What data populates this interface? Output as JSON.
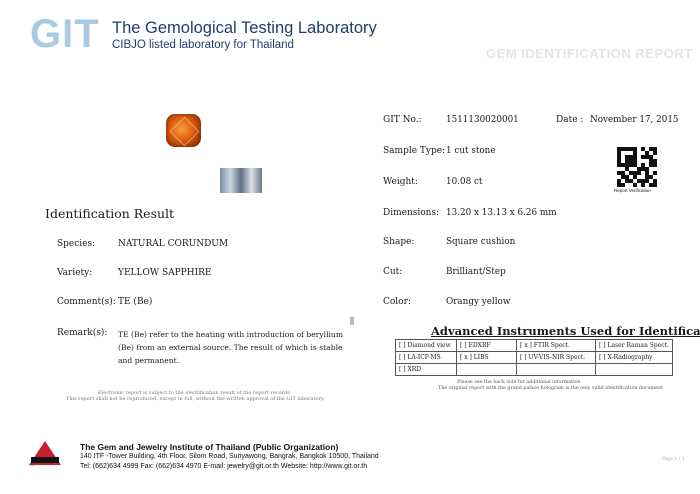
{
  "header": {
    "logo": "GIT",
    "title": "The Gemological Testing Laboratory",
    "subtitle": "CIBJO listed laboratory for Thailand",
    "watermark": "GEM IDENTIFICATION REPORT"
  },
  "identification": {
    "heading": "Identification Result",
    "species": {
      "label": "Species:",
      "value": "NATURAL  CORUNDUM"
    },
    "variety": {
      "label": "Variety:",
      "value": "YELLOW  SAPPHIRE"
    },
    "comments": {
      "label": "Comment(s):",
      "value": "TE (Be)"
    },
    "remarks": {
      "label": "Remark(s):",
      "value": "TE (Be) refer to the heating with introduction of beryllium (Be) from an external source. The result of which is stable and permanent."
    }
  },
  "disclaimer": {
    "line1": "Electronic report is subject to the identification result of the report records.",
    "line2": "This report shall not be reproduced, except in full, without the written approval of the GIT laboratory."
  },
  "report": {
    "git_no": {
      "label": "GIT No.:",
      "value": "1511130020001"
    },
    "date": {
      "label": "Date :",
      "value": "November 17, 2015"
    },
    "sample_type": {
      "label": "Sample Type:",
      "value": "1 cut stone"
    },
    "weight": {
      "label": "Weight:",
      "value": "10.08  ct"
    },
    "dimensions": {
      "label": "Dimensions:",
      "value": "13.20 x 13.13 x 6.26 mm"
    },
    "shape": {
      "label": "Shape:",
      "value": "Square cushion"
    },
    "cut": {
      "label": "Cut:",
      "value": "Brilliant/Step"
    },
    "color": {
      "label": "Color:",
      "value": "Orangy yellow"
    },
    "qr_caption": "Report Verification"
  },
  "instruments": {
    "title": "Advanced Instruments Used for Identification",
    "rows": [
      [
        "[   ] Diamond view",
        "[   ] EDXRF",
        "[ x ] FTIR Spect.",
        "[   ] Laser Raman Spect."
      ],
      [
        "[   ] LA-ICP-MS",
        "[ x ] LIBS",
        "[   ] UV-VIS-NIR Spect.",
        "[   ] X-Radiography"
      ],
      [
        "[   ] XRD",
        "",
        "",
        ""
      ]
    ],
    "note1": "Please see the back side for additional information",
    "note2": "The original report with the grand palace hologram is the only valid identification document"
  },
  "footer": {
    "logo_text": "GIT",
    "org": "The Gem and Jewelry Institute of Thailand (Public Organization)",
    "address": "140 ITF -Tower Building, 4th Floor, Silom Road, Suriyawong, Bangrak, Bangkok 10500, Thailand",
    "contact": "Tel: (662)634 4999 Fax: (662)634 4970  E-mail: jewelry@git.or.th  Website: http://www.git.or.th",
    "page": "Page 1 / 1"
  },
  "colors": {
    "brand_blue": "#1f3d6e",
    "logo_light_blue": "#a9cbe0",
    "institute_red": "#c8202f",
    "gem_orange": "#e76a13"
  }
}
